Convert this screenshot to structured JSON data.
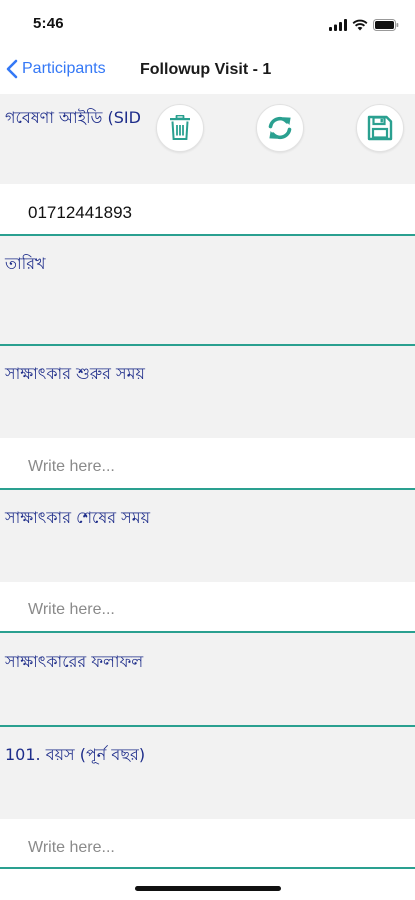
{
  "status": {
    "time": "5:46"
  },
  "nav": {
    "back_label": "Participants",
    "title": "Followup Visit - 1"
  },
  "actions": [
    {
      "name": "delete",
      "icon": "trash-icon"
    },
    {
      "name": "refresh",
      "icon": "refresh-icon"
    },
    {
      "name": "save",
      "icon": "save-icon"
    }
  ],
  "colors": {
    "accent": "#2aa090",
    "label": "#1e2d8a",
    "link": "#3478f6"
  },
  "form": {
    "research_id": {
      "label": "গবেষণা আইডি (SID",
      "value": "01712441893"
    },
    "date": {
      "label": "তারিখ"
    },
    "interview_start": {
      "label": "সাক্ষাৎকার শুরুর সময়",
      "placeholder": "Write here..."
    },
    "interview_end": {
      "label": "সাক্ষাৎকার শেষের সময়",
      "placeholder": "Write here..."
    },
    "interview_result": {
      "label": "সাক্ষাৎকারের ফলাফল"
    },
    "age": {
      "label": "101. বয়স (পূর্ন বছর)",
      "placeholder": "Write here..."
    }
  }
}
